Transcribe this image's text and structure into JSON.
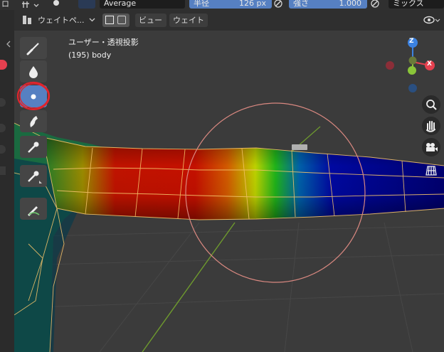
{
  "top_header": {
    "blend_value": "Average",
    "radius_label": "半径",
    "radius_value": "126 px",
    "strength_label": "強さ",
    "strength_value": "1.000",
    "mix_label": "ミックス",
    "left_fragment": "ロ"
  },
  "tool_header": {
    "mode_label": "ウェイトペ...",
    "view_menu": "ビュー",
    "weight_menu": "ウェイト"
  },
  "viewport": {
    "view_name": "ユーザー・透視投影",
    "object_info": "(195) body"
  },
  "gizmo": {
    "z_label": "Z",
    "x_label": "X",
    "colors": {
      "x": "#e5404f",
      "y": "#8ac539",
      "z": "#3c82e0"
    }
  },
  "toolbar": {
    "tools": [
      "brush-icon",
      "blur-drop-icon",
      "average-icon",
      "smear-icon",
      "sample-weight-icon",
      "gradient-icon",
      "annotate-icon"
    ],
    "active_tool": "average-icon"
  },
  "nav_buttons": [
    "zoom-icon",
    "hand-icon",
    "camera-icon",
    "grid-icon"
  ],
  "colors": {
    "accent": "#5680c2",
    "highlight_circle": "#e0242c",
    "brush_circle": "#d98880",
    "grid_line": "#6e9a2e"
  }
}
